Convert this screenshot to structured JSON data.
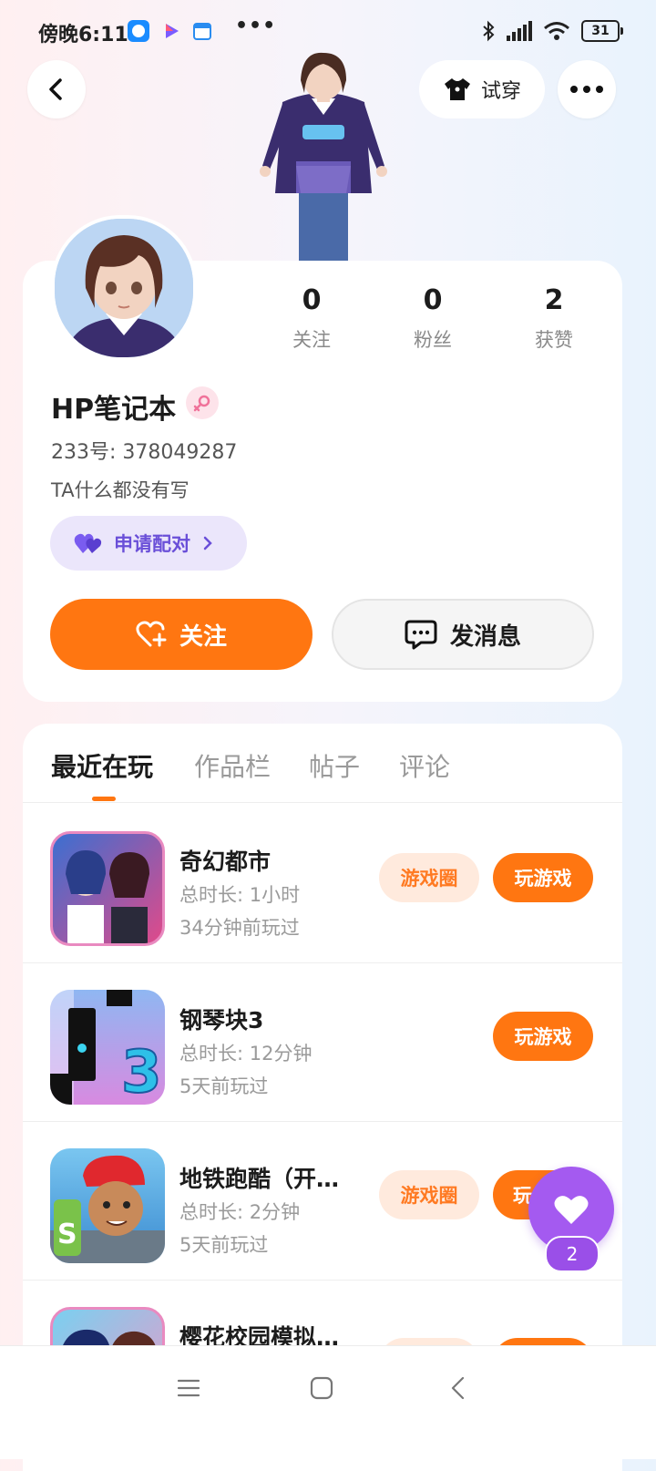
{
  "status_bar": {
    "time": "傍晚6:11",
    "dots": "•••",
    "battery": "31"
  },
  "header": {
    "try_on_label": "试穿"
  },
  "profile": {
    "stats": [
      {
        "value": "0",
        "label": "关注"
      },
      {
        "value": "0",
        "label": "粉丝"
      },
      {
        "value": "2",
        "label": "获赞"
      }
    ],
    "username": "HP笔记本",
    "uid": "233号: 378049287",
    "bio": "TA什么都没有写",
    "pair_label": "申请配对",
    "follow_label": "关注",
    "message_label": "发消息"
  },
  "tabs": [
    {
      "label": "最近在玩"
    },
    {
      "label": "作品栏"
    },
    {
      "label": "帖子"
    },
    {
      "label": "评论"
    }
  ],
  "games": [
    {
      "name": "奇幻都市",
      "duration": "总时长: 1小时",
      "last_played": "34分钟前玩过",
      "circle_label": "游戏圈",
      "play_label": "玩游戏"
    },
    {
      "name": "钢琴块3",
      "duration": "总时长: 12分钟",
      "last_played": "5天前玩过",
      "play_label": "玩游戏"
    },
    {
      "name": "地铁跑酷（开…",
      "duration": "总时长: 2分钟",
      "last_played": "5天前玩过",
      "circle_label": "游戏圈",
      "play_label": "玩"
    },
    {
      "name": "樱花校园模拟…"
    }
  ],
  "fab": {
    "count": "2"
  },
  "colors": {
    "accent": "#ff7611",
    "pair": "#6a4fd8",
    "fab": "#a45af0"
  }
}
